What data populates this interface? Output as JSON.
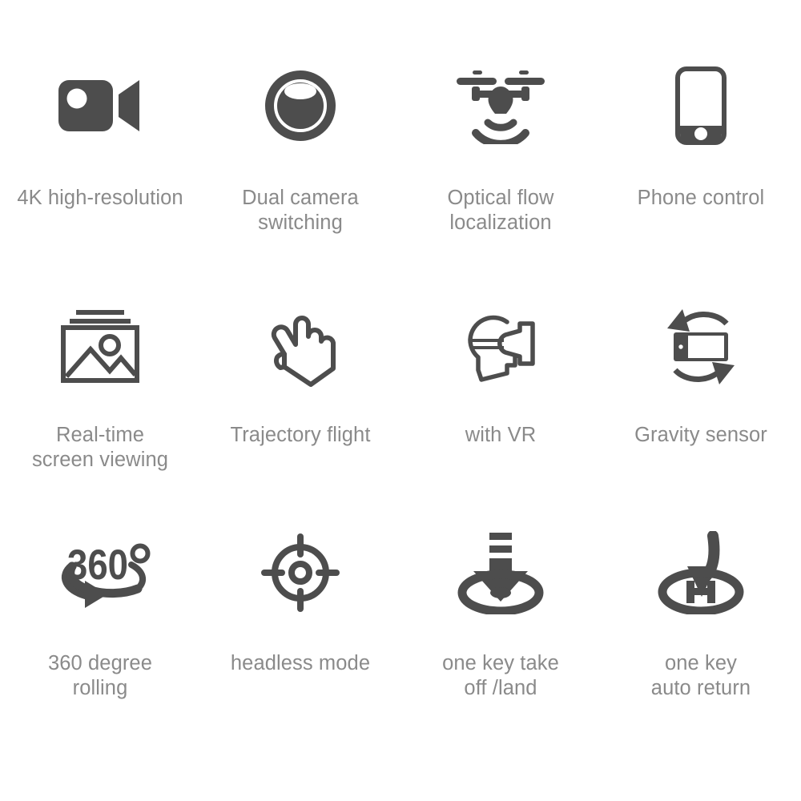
{
  "page": {
    "background_color": "#ffffff",
    "icon_color": "#4d4d4d",
    "label_color": "#8a8a8a"
  },
  "features": [
    {
      "icon": "video-camera-icon",
      "label": "4K high-resolution"
    },
    {
      "icon": "dual-camera-lens-icon",
      "label": "Dual camera\nswitching"
    },
    {
      "icon": "drone-signal-icon",
      "label": "Optical flow\nlocalization"
    },
    {
      "icon": "smartphone-icon",
      "label": "Phone control"
    },
    {
      "icon": "photo-gallery-icon",
      "label": "Real-time\nscreen viewing"
    },
    {
      "icon": "pointing-hand-icon",
      "label": "Trajectory flight"
    },
    {
      "icon": "vr-headset-icon",
      "label": "with VR"
    },
    {
      "icon": "rotate-device-icon",
      "label": "Gravity sensor"
    },
    {
      "icon": "360-degree-rotation-icon",
      "label": "360 degree\nrolling"
    },
    {
      "icon": "crosshair-target-icon",
      "label": "headless mode"
    },
    {
      "icon": "takeoff-landing-arrow-icon",
      "label": "one key take\noff /land"
    },
    {
      "icon": "auto-return-helipad-icon",
      "label": "one key\nauto return"
    }
  ]
}
